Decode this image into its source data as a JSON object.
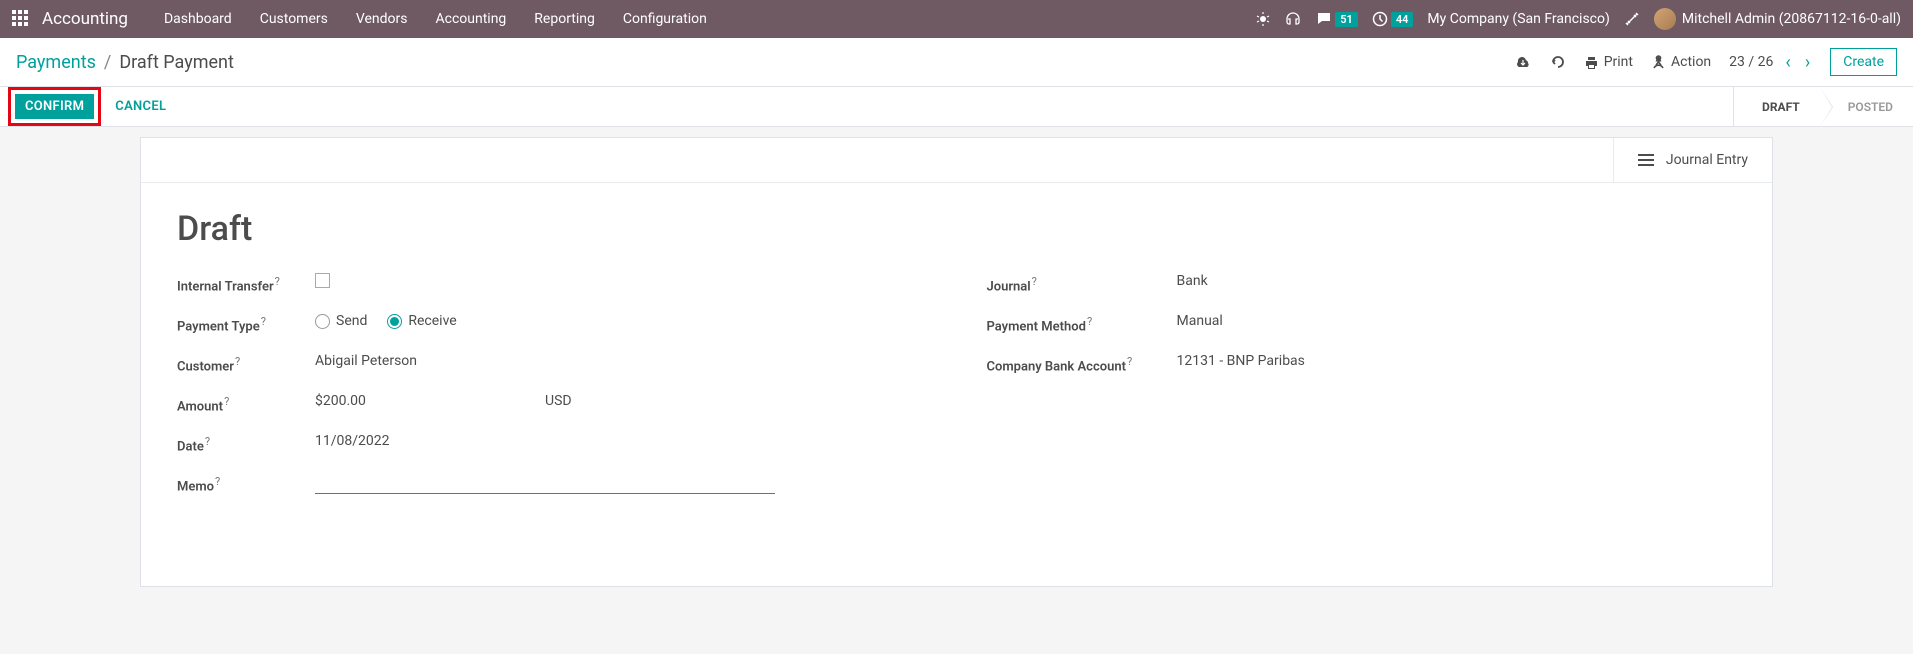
{
  "topbar": {
    "app_name": "Accounting",
    "nav": [
      "Dashboard",
      "Customers",
      "Vendors",
      "Accounting",
      "Reporting",
      "Configuration"
    ],
    "messages_badge": "51",
    "activities_badge": "44",
    "company": "My Company (San Francisco)",
    "user": "Mitchell Admin (20867112-16-0-all)"
  },
  "breadcrumb": {
    "parent": "Payments",
    "current": "Draft Payment"
  },
  "toolbar": {
    "print_label": "Print",
    "action_label": "Action",
    "pager_current": "23",
    "pager_total": "26",
    "create_label": "Create"
  },
  "actions": {
    "confirm": "CONFIRM",
    "cancel": "CANCEL"
  },
  "status": {
    "draft": "DRAFT",
    "posted": "POSTED"
  },
  "sheet": {
    "journal_entry_label": "Journal Entry",
    "title": "Draft",
    "labels": {
      "internal_transfer": "Internal Transfer",
      "payment_type": "Payment Type",
      "customer": "Customer",
      "amount": "Amount",
      "date": "Date",
      "memo": "Memo",
      "journal": "Journal",
      "payment_method": "Payment Method",
      "company_bank_account": "Company Bank Account"
    },
    "payment_type_options": {
      "send": "Send",
      "receive": "Receive"
    },
    "values": {
      "customer": "Abigail Peterson",
      "amount": "$200.00",
      "currency": "USD",
      "date": "11/08/2022",
      "memo": "",
      "journal": "Bank",
      "payment_method": "Manual",
      "company_bank_account": "12131 - BNP Paribas"
    }
  }
}
